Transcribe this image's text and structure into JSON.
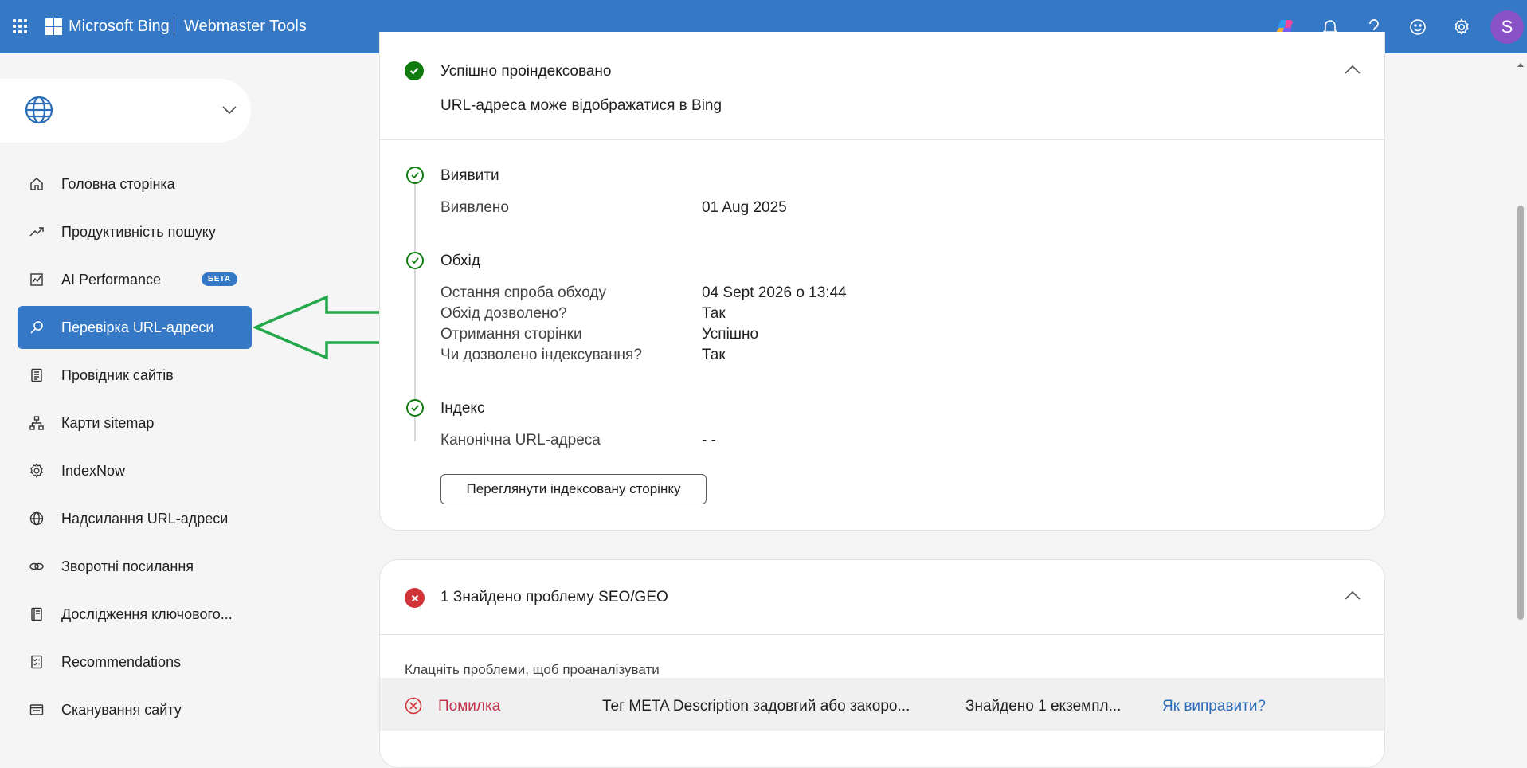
{
  "header": {
    "brand": "Microsoft Bing",
    "product": "Webmaster Tools",
    "avatar_initial": "S",
    "icons": [
      "app-launcher-icon",
      "microsoft-logo-icon",
      "copilot-icon",
      "bell-icon",
      "help-icon",
      "smiley-icon",
      "gear-icon"
    ]
  },
  "sidebar": {
    "site_selector": {
      "icon": "globe-icon",
      "value": ""
    },
    "items": [
      {
        "label": "Головна сторінка",
        "icon": "home-icon"
      },
      {
        "label": "Продуктивність пошуку",
        "icon": "trend-icon"
      },
      {
        "label": "AI Performance",
        "icon": "chart-icon",
        "badge": "БЕТА"
      },
      {
        "label": "Перевірка URL-адреси",
        "icon": "search-icon",
        "active": true
      },
      {
        "label": "Провідник сайтів",
        "icon": "document-icon"
      },
      {
        "label": "Карти sitemap",
        "icon": "sitemap-icon"
      },
      {
        "label": "IndexNow",
        "icon": "gear-icon"
      },
      {
        "label": "Надсилання URL-адреси",
        "icon": "globe-icon"
      },
      {
        "label": "Зворотні посилання",
        "icon": "link-icon"
      },
      {
        "label": "Дослідження ключового...",
        "icon": "notebook-icon"
      },
      {
        "label": "Recommendations",
        "icon": "checklist-icon"
      },
      {
        "label": "Сканування сайту",
        "icon": "scan-icon"
      }
    ]
  },
  "index_card": {
    "status_title": "Успішно проіндексовано",
    "status_subtitle": "URL-адреса може відображатися в Bing",
    "steps": {
      "discover": {
        "title": "Виявити",
        "rows": [
          {
            "label": "Виявлено",
            "value": "01 Aug 2025"
          }
        ]
      },
      "crawl": {
        "title": "Обхід",
        "rows": [
          {
            "label": "Остання спроба обходу",
            "value": "04 Sept 2026 о 13:44"
          },
          {
            "label": "Обхід дозволено?",
            "value": "Так"
          },
          {
            "label": "Отримання сторінки",
            "value": "Успішно"
          },
          {
            "label": "Чи дозволено індексування?",
            "value": "Так"
          }
        ]
      },
      "index": {
        "title": "Індекс",
        "rows": [
          {
            "label": "Канонічна URL-адреса",
            "value": "- -"
          }
        ]
      }
    },
    "view_button": "Переглянути індексовану сторінку"
  },
  "issues_card": {
    "title": "1 Знайдено проблему SEO/GEO",
    "hint": "Клацніть проблеми, щоб проаналізувати",
    "rows": [
      {
        "severity": "Помилка",
        "description": "Тег META Description задовгий або закоро...",
        "count": "Знайдено 1 екземпл...",
        "fix": "Як виправити?"
      }
    ]
  },
  "colors": {
    "header_bg": "#3478c6",
    "accent": "#3478c6",
    "success": "#107c10",
    "error": "#d13438",
    "annotation_arrow": "#22a84a"
  }
}
